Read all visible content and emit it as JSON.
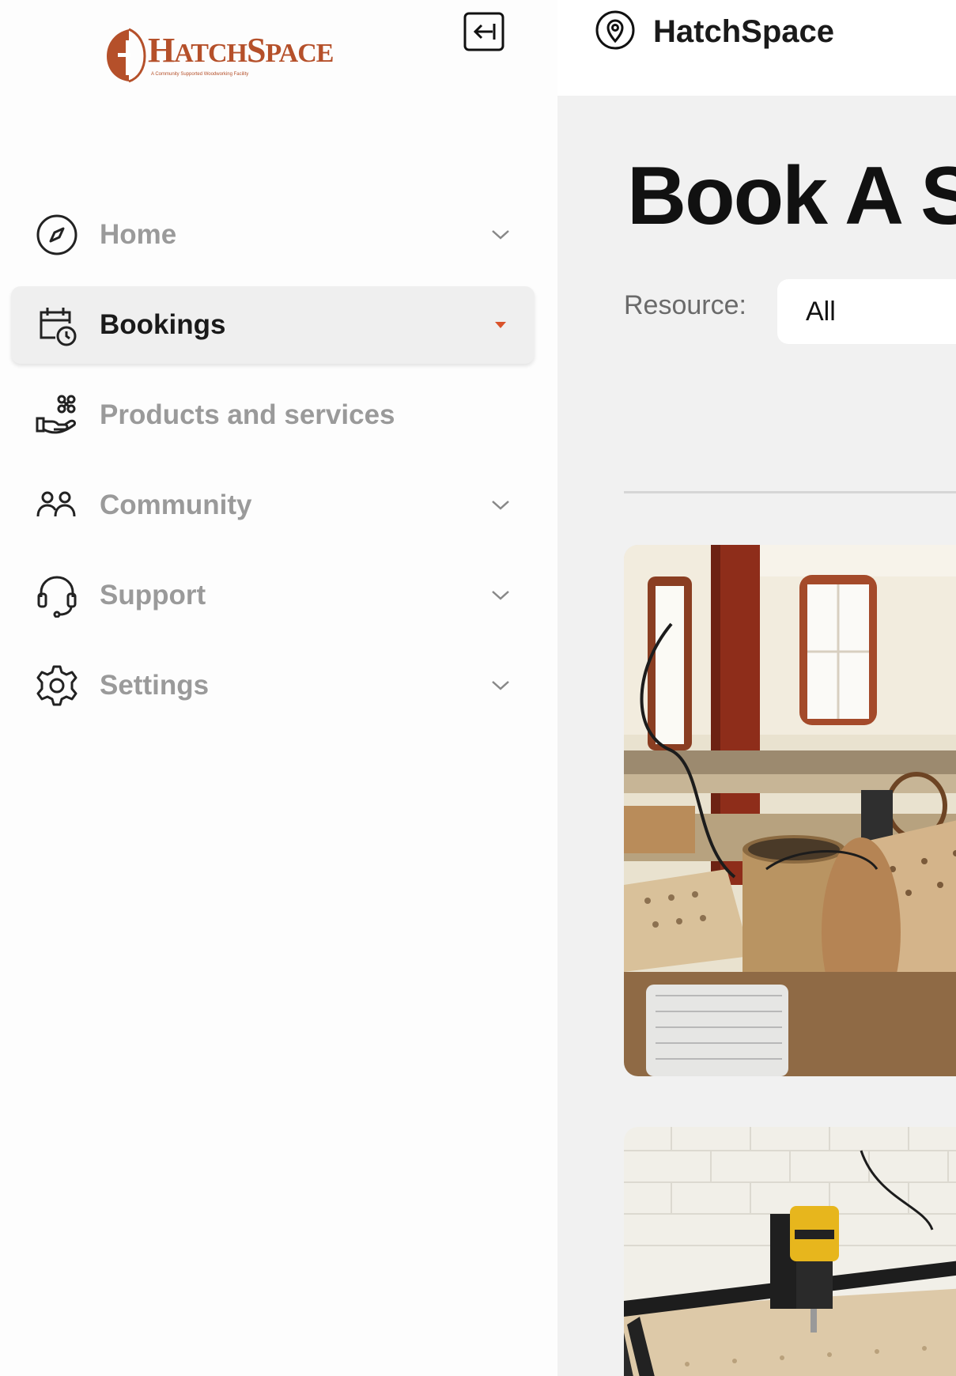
{
  "app": {
    "logo_text_big_h": "H",
    "logo_text_atch": "ATCH",
    "logo_text_big_s": "S",
    "logo_text_pace": "PACE",
    "logo_tagline": "A Community Supported Woodworking Facility",
    "location_name": "HatchSpace"
  },
  "sidebar": {
    "items": [
      {
        "label": "Home",
        "icon": "compass-icon",
        "has_chevron": true,
        "active": false
      },
      {
        "label": "Bookings",
        "icon": "calendar-clock-icon",
        "has_chevron": true,
        "active": true
      },
      {
        "label": "Products and services",
        "icon": "hand-products-icon",
        "has_chevron": false,
        "active": false
      },
      {
        "label": "Community",
        "icon": "people-icon",
        "has_chevron": true,
        "active": false
      },
      {
        "label": "Support",
        "icon": "headset-icon",
        "has_chevron": true,
        "active": false
      },
      {
        "label": "Settings",
        "icon": "gear-icon",
        "has_chevron": true,
        "active": false
      }
    ]
  },
  "main": {
    "title": "Book A S",
    "filter_label": "Resource:",
    "filter_value": "All"
  },
  "colors": {
    "brand": "#b5502a",
    "active_chevron": "#d9532b",
    "main_bg": "#f1f1f1"
  }
}
